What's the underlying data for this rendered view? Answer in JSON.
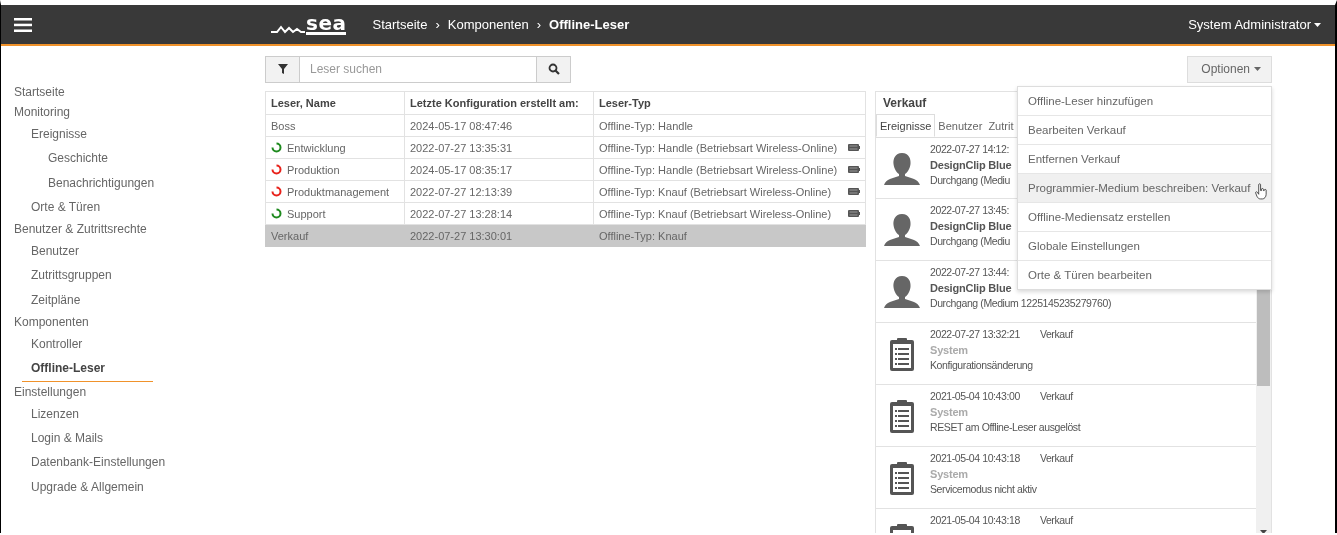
{
  "header": {
    "logo_text": "sea",
    "breadcrumb": [
      {
        "label": "Startseite",
        "current": false
      },
      {
        "label": "Komponenten",
        "current": false
      },
      {
        "label": "Offline-Leser",
        "current": true
      }
    ],
    "separator": "›",
    "user": "System Administrator"
  },
  "sidebar": {
    "items": [
      {
        "label": "Startseite",
        "selected": false
      },
      {
        "label": "Monitoring",
        "selected": false,
        "children": [
          {
            "label": "Ereignisse",
            "selected": false,
            "children": [
              {
                "label": "Geschichte",
                "selected": false
              },
              {
                "label": "Benachrichtigungen",
                "selected": false
              }
            ]
          },
          {
            "label": "Orte & Türen",
            "selected": false
          }
        ]
      },
      {
        "label": "Benutzer & Zutrittsrechte",
        "selected": false,
        "children": [
          {
            "label": "Benutzer",
            "selected": false
          },
          {
            "label": "Zutrittsgruppen",
            "selected": false
          },
          {
            "label": "Zeitpläne",
            "selected": false
          }
        ]
      },
      {
        "label": "Komponenten",
        "selected": false,
        "children": [
          {
            "label": "Kontroller",
            "selected": false
          },
          {
            "label": "Offline-Leser",
            "selected": true
          }
        ]
      },
      {
        "label": "Einstellungen",
        "selected": false,
        "children": [
          {
            "label": "Lizenzen",
            "selected": false
          },
          {
            "label": "Login & Mails",
            "selected": false
          },
          {
            "label": "Datenbank-Einstellungen",
            "selected": false
          },
          {
            "label": "Upgrade & Allgemein",
            "selected": false
          }
        ]
      }
    ]
  },
  "search": {
    "placeholder": "Leser suchen"
  },
  "options_button": "Optionen",
  "table": {
    "columns": [
      "Leser, Name",
      "Letzte Konfiguration erstellt am:",
      "Leser-Typ"
    ],
    "rows": [
      {
        "name": "Boss",
        "date": "2024-05-17 08:47:46",
        "type": "Offline-Typ: Handle",
        "battery": false,
        "selected": false
      },
      {
        "name": "Entwicklung",
        "date": "2022-07-27 13:35:31",
        "type": "Offline-Typ: Handle (Betriebsart Wireless-Online)",
        "color": "#1e8a1e",
        "battery": true,
        "selected": false
      },
      {
        "name": "Produktion",
        "date": "2024-05-17 08:35:17",
        "type": "Offline-Typ: Handle (Betriebsart Wireless-Online)",
        "color": "#e8221b",
        "battery": true,
        "selected": false
      },
      {
        "name": "Produktmanagement",
        "date": "2022-07-27 12:13:39",
        "type": "Offline-Typ: Knauf (Betriebsart Wireless-Online)",
        "color": "#e8221b",
        "battery": true,
        "selected": false
      },
      {
        "name": "Support",
        "date": "2022-07-27 13:28:14",
        "type": "Offline-Typ: Knauf (Betriebsart Wireless-Online)",
        "color": "#1e8a1e",
        "battery": true,
        "selected": false
      },
      {
        "name": "Verkauf",
        "date": "2022-07-27 13:30:01",
        "type": "Offline-Typ: Knauf",
        "battery": false,
        "selected": true
      }
    ]
  },
  "detail": {
    "title": "Verkauf",
    "tabs": [
      {
        "label": "Ereignisse",
        "selected": true
      },
      {
        "label": "Benutzer",
        "selected": false
      },
      {
        "label": "Zutrit",
        "selected": false
      }
    ],
    "events": [
      {
        "kind": "user",
        "time": "2022-07-27 14:12:",
        "who": "DesignClip Blue",
        "text": "Durchgang (Mediu"
      },
      {
        "kind": "user",
        "time": "2022-07-27 13:45:",
        "who": "DesignClip Blue",
        "text": "Durchgang (Mediu"
      },
      {
        "kind": "user",
        "time": "2022-07-27 13:44:",
        "who": "DesignClip Blue",
        "text": "Durchgang (Medium 1225145235279760)"
      },
      {
        "kind": "system",
        "time": "2022-07-27 13:32:21",
        "place": "Verkauf",
        "who": "System",
        "text": "Konfigurationsänderung"
      },
      {
        "kind": "system",
        "time": "2021-05-04 10:43:00",
        "place": "Verkauf",
        "who": "System",
        "text": "RESET am Offline-Leser ausgelöst"
      },
      {
        "kind": "system",
        "time": "2021-05-04 10:43:18",
        "place": "Verkauf",
        "who": "System",
        "text": "Servicemodus nicht aktiv"
      },
      {
        "kind": "system",
        "time": "2021-05-04 10:43:18",
        "place": "Verkauf"
      }
    ]
  },
  "options_menu": [
    {
      "label": "Offline-Leser hinzufügen",
      "highlighted": false
    },
    {
      "label": "Bearbeiten Verkauf",
      "highlighted": false
    },
    {
      "label": "Entfernen Verkauf",
      "highlighted": false
    },
    {
      "label": "Programmier-Medium beschreiben: Verkauf",
      "highlighted": true
    },
    {
      "label": "Offline-Mediensatz erstellen",
      "highlighted": false
    },
    {
      "label": "Globale Einstellungen",
      "highlighted": false
    },
    {
      "label": "Orte & Türen bearbeiten",
      "highlighted": false
    }
  ]
}
